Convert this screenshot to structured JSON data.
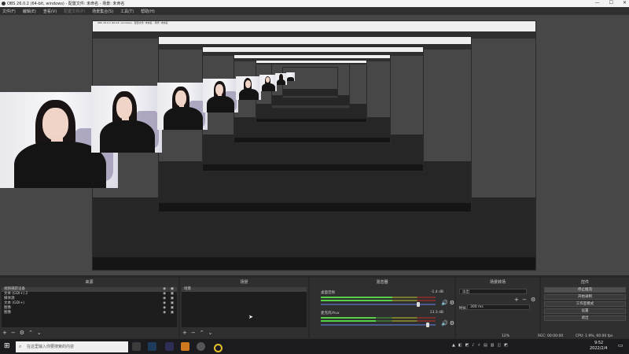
{
  "window": {
    "title": "OBS 26.0.2 (64-bit, windows) - 配置文件: 未命名 - 场景: 未命名",
    "minimize_glyph": "—",
    "maximize_glyph": "☐",
    "close_glyph": "✕"
  },
  "menu": [
    "文件(F)",
    "编辑(E)",
    "查看(V)",
    "配置文件(P)",
    "场景集合(S)",
    "工具(T)",
    "帮助(H)"
  ],
  "canvas": {
    "nested_title": "OBS 26.0.2 (64-bit, windows) - 配置文件: 未命名 - 场景: 未命名"
  },
  "docks": {
    "sources": {
      "title": "来源",
      "items": [
        {
          "label": "视频捕获设备"
        },
        {
          "label": "文本 (GDI+) 2"
        },
        {
          "label": "媒体源"
        },
        {
          "label": "文本 (GDI+)"
        },
        {
          "label": "图像"
        },
        {
          "label": "图像"
        }
      ]
    },
    "scenes": {
      "title": "场景",
      "items": [
        {
          "label": "场景"
        }
      ]
    },
    "mixer": {
      "title": "混音器",
      "channels": [
        {
          "name": "桌面音频",
          "db": "-1.4 dB",
          "level": 0.62,
          "volume": 0.85
        },
        {
          "name": "麦克风/Aux",
          "db": "13.3 dB",
          "level": 0.48,
          "volume": 0.93
        }
      ]
    },
    "transitions": {
      "title": "场景转场",
      "selected": "淡出",
      "duration_label": "时长",
      "duration_value": "300 ms"
    },
    "controls": {
      "title": "控件",
      "buttons": [
        "停止推流",
        "开始录制",
        "工作室模式",
        "设置",
        "退出"
      ]
    }
  },
  "statusbar": {
    "dropped": "12%",
    "live": "REC: 00:00:00",
    "cpu": "CPU: 1.9%, 60.00 fps",
    "time": "9:52",
    "date": "2022/2/4"
  },
  "taskbar": {
    "search_placeholder": "在这里输入你要搜索的内容"
  },
  "colors": {
    "accent_green": "#58d04b",
    "slider_blue": "#4a5a8f",
    "panel_bg": "#2f2f2f"
  }
}
